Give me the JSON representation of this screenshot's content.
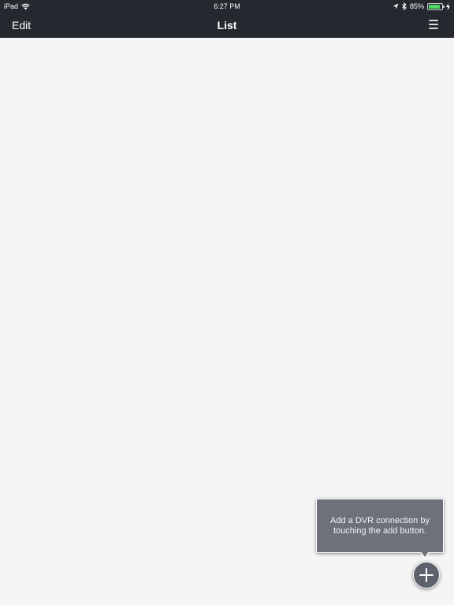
{
  "status_bar": {
    "device": "iPad",
    "time": "6:27 PM",
    "battery": "85%",
    "battery_level": 0.85,
    "icons": [
      "wifi-icon",
      "location-icon",
      "bluetooth-icon",
      "battery-icon",
      "charging-icon"
    ]
  },
  "nav_bar": {
    "edit_label": "Edit",
    "title": "List",
    "menu_icon": "hamburger-menu-icon"
  },
  "tooltip": {
    "text": "Add a DVR connection by touching the add button."
  },
  "add_button": {
    "icon": "plus-icon"
  },
  "colors": {
    "bar_background": "#25282e",
    "content_background": "#f5f5f5",
    "tooltip_background": "#6c717b",
    "add_button_background": "#5c616b",
    "battery_green": "#4cd964"
  }
}
